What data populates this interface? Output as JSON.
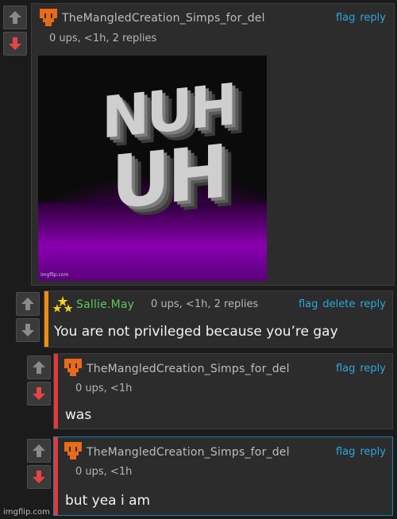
{
  "comments": [
    {
      "username": "TheMangledCreation_Simps_for_del",
      "meta": "0 ups, <1h, 2 replies",
      "actions": [
        "flag",
        "reply"
      ],
      "image_watermark": "imgflip.com",
      "image_text": [
        "NUH",
        "UH"
      ]
    },
    {
      "username": "Sallie.May",
      "meta": "0 ups, <1h, 2 replies",
      "actions": [
        "flag",
        "delete",
        "reply"
      ],
      "text": "You are not privileged because you’re gay",
      "bar_color": "#f28c10",
      "name_color": "#5cc85c"
    },
    {
      "username": "TheMangledCreation_Simps_for_del",
      "meta": "0 ups, <1h",
      "actions": [
        "flag",
        "reply"
      ],
      "text": "was",
      "bar_color": "#e03a3a"
    },
    {
      "username": "TheMangledCreation_Simps_for_del",
      "meta": "0 ups, <1h",
      "actions": [
        "flag",
        "reply"
      ],
      "text": "but yea i am",
      "bar_color": "#e03a3a"
    }
  ],
  "footer_watermark": "imgflip.com",
  "colors": {
    "link": "#29a8e0",
    "downvote_active": "#e84444",
    "upvote": "#8a8a8a"
  }
}
